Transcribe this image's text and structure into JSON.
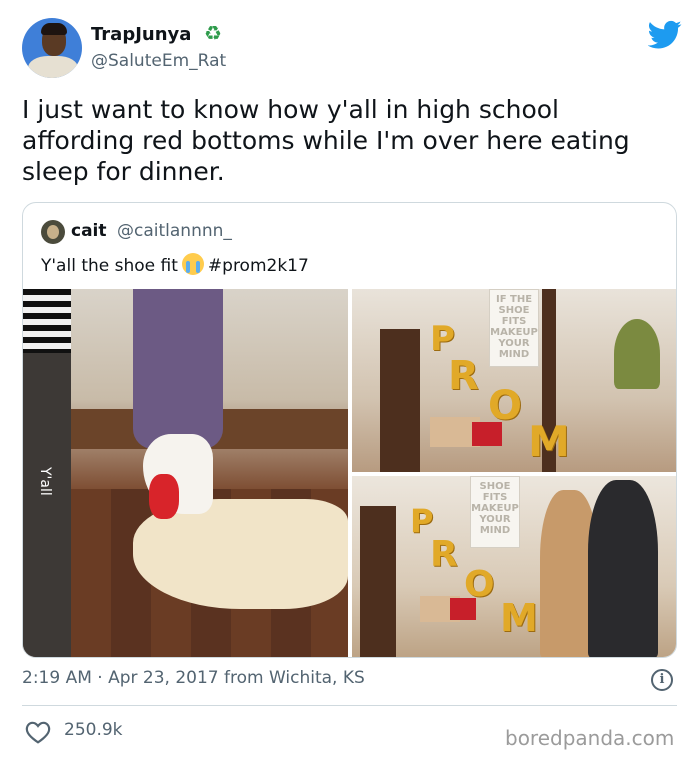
{
  "author": {
    "display_name": "TrapJunya",
    "handle": "@SaluteEm_Rat",
    "badge_icon": "recycle-icon"
  },
  "tweet": {
    "text": "I just want to know how y'all in high school affording red bottoms while I'm over here eating sleep for dinner."
  },
  "quoted_tweet": {
    "name": "cait",
    "handle": "@caitlannnn_",
    "text_before": "Y'all the shoe fit",
    "emoji_icon": "loudly-crying-face-icon",
    "hashtag": "#prom2k17",
    "photo_text": {
      "yall": "Y'all",
      "sign_top": "IF THE SHOE FITS MAKEUP YOUR MIND",
      "sign_bottom": "SHOE FITS MAKEUP YOUR MIND",
      "balloons": [
        "P",
        "R",
        "O",
        "M"
      ]
    }
  },
  "meta": {
    "timestamp": "2:19 AM · Apr 23, 2017 from Wichita, KS"
  },
  "footer": {
    "like_count": "250.9k",
    "watermark": "boredpanda.com"
  },
  "colors": {
    "twitter_blue": "#1d9bf0",
    "text_primary": "#0f1419",
    "text_secondary": "#536471",
    "border": "#cfd9de"
  }
}
